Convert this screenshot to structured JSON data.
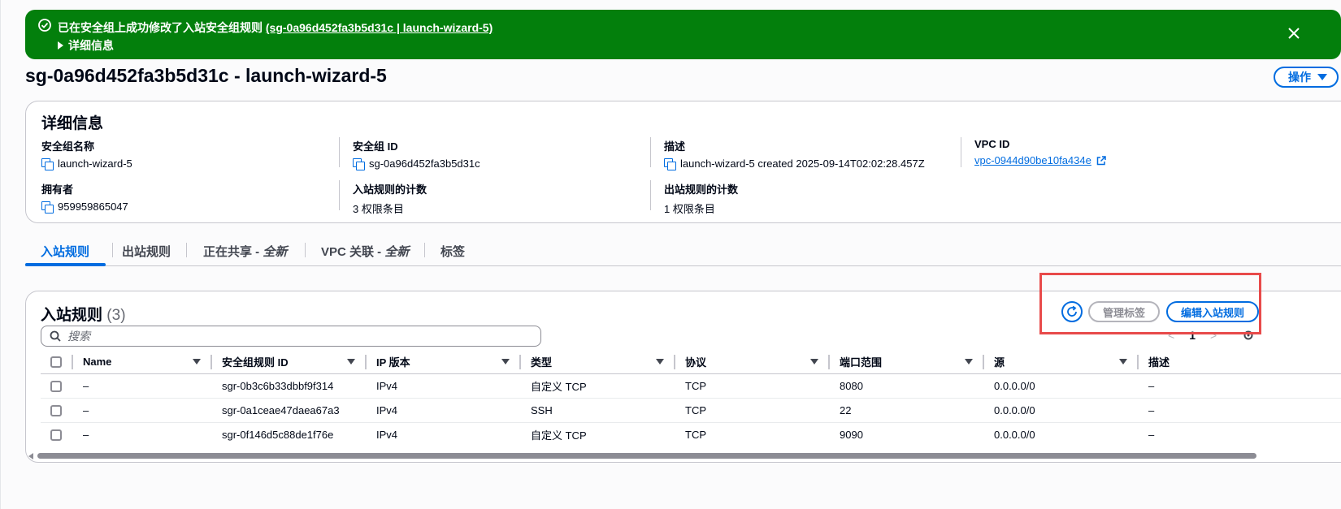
{
  "flash": {
    "message_prefix": "已在安全组上成功修改了入站安全组规则",
    "message_link": "(sg-0a96d452fa3b5d31c | launch-wizard-5)",
    "details_label": "详细信息",
    "color": "#037f0c"
  },
  "page": {
    "title": "sg-0a96d452fa3b5d31c - launch-wizard-5",
    "actions_label": "操作"
  },
  "details": {
    "heading": "详细信息",
    "sg_name_label": "安全组名称",
    "sg_name_value": "launch-wizard-5",
    "sg_id_label": "安全组 ID",
    "sg_id_value": "sg-0a96d452fa3b5d31c",
    "description_label": "描述",
    "description_value": "launch-wizard-5 created 2025-09-14T02:02:28.457Z",
    "vpc_id_label": "VPC ID",
    "vpc_id_value": "vpc-0944d90be10fa434e",
    "owner_label": "拥有者",
    "owner_value": "959959865047",
    "inbound_count_label": "入站规则的计数",
    "inbound_count_value": "3 权限条目",
    "outbound_count_label": "出站规则的计数",
    "outbound_count_value": "1 权限条目"
  },
  "tabs": [
    {
      "label": "入站规则",
      "suffix": ""
    },
    {
      "label": "出站规则",
      "suffix": ""
    },
    {
      "label": "正在共享 - ",
      "suffix": "全新"
    },
    {
      "label": "VPC 关联 - ",
      "suffix": "全新"
    },
    {
      "label": "标签",
      "suffix": ""
    }
  ],
  "rules": {
    "title": "入站规则",
    "count": "(3)",
    "search_placeholder": "搜索",
    "manage_tags_label": "管理标签",
    "edit_label": "编辑入站规则",
    "page_number": "1",
    "columns": [
      "Name",
      "安全组规则 ID",
      "IP 版本",
      "类型",
      "协议",
      "端口范围",
      "源",
      "描述"
    ],
    "rows": [
      [
        "–",
        "sgr-0b3c6b33dbbf9f314",
        "IPv4",
        "自定义 TCP",
        "TCP",
        "8080",
        "0.0.0.0/0",
        "–"
      ],
      [
        "–",
        "sgr-0a1ceae47daea67a3",
        "IPv4",
        "SSH",
        "TCP",
        "22",
        "0.0.0.0/0",
        "–"
      ],
      [
        "–",
        "sgr-0f146d5c88de1f76e",
        "IPv4",
        "自定义 TCP",
        "TCP",
        "9090",
        "0.0.0.0/0",
        "–"
      ]
    ]
  },
  "colors": {
    "accent": "#006ce0",
    "highlight": "#e84a4a"
  }
}
